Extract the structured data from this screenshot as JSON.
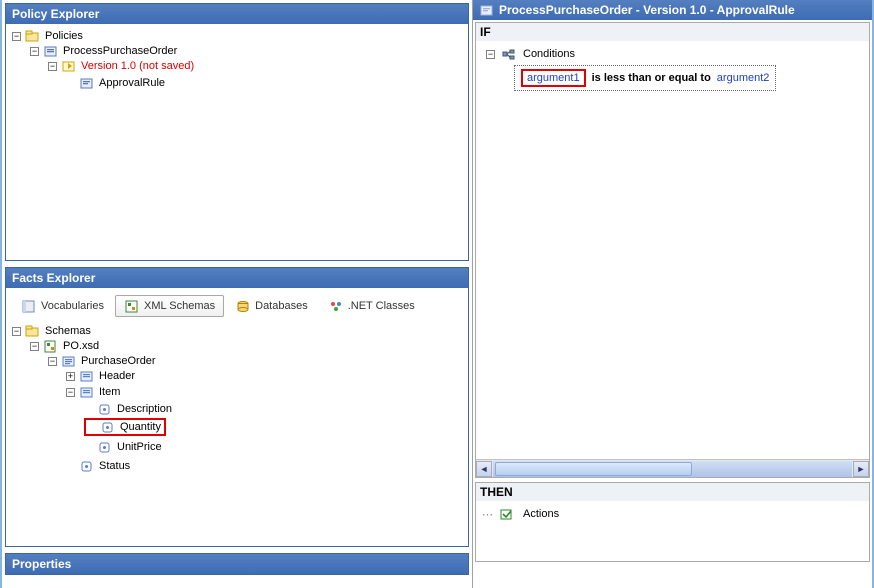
{
  "policyExplorer": {
    "title": "Policy Explorer",
    "root": "Policies",
    "policy": "ProcessPurchaseOrder",
    "version": "Version 1.0 (not saved)",
    "rule": "ApprovalRule"
  },
  "factsExplorer": {
    "title": "Facts Explorer",
    "tabs": {
      "vocabularies": "Vocabularies",
      "xmlSchemas": "XML Schemas",
      "databases": "Databases",
      "netClasses": ".NET Classes"
    },
    "tree": {
      "root": "Schemas",
      "file": "PO.xsd",
      "rootElement": "PurchaseOrder",
      "header": "Header",
      "item": "Item",
      "itemChildren": {
        "description": "Description",
        "quantity": "Quantity",
        "unitPrice": "UnitPrice"
      },
      "status": "Status"
    }
  },
  "properties": {
    "title": "Properties"
  },
  "ruleEditor": {
    "title": "ProcessPurchaseOrder - Version 1.0 - ApprovalRule",
    "ifLabel": "IF",
    "thenLabel": "THEN",
    "conditions": "Conditions",
    "argument1": "argument1",
    "operator": "is less than or equal to",
    "argument2": "argument2",
    "actions": "Actions"
  },
  "glyphs": {
    "minus": "−",
    "plus": "+"
  }
}
